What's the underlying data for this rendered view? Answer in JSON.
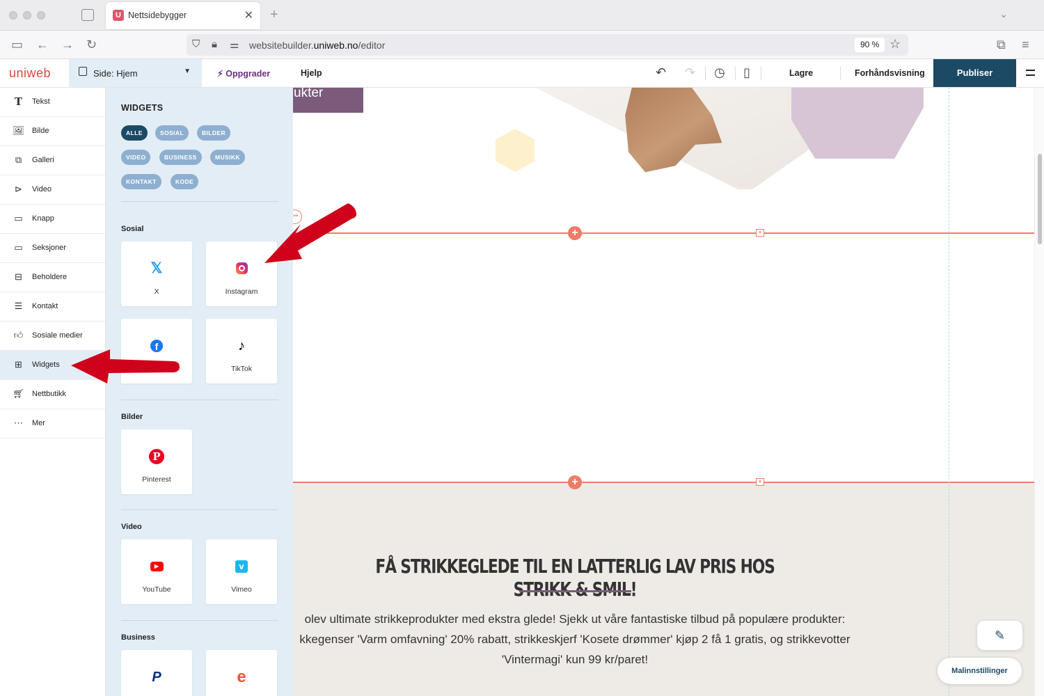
{
  "browser": {
    "tab_title": "Nettsidebygger",
    "tab_favicon": "U",
    "url_prefix": "websitebuilder.",
    "url_domain": "uniweb.no",
    "url_path": "/editor",
    "zoom": "90 %"
  },
  "toolbar": {
    "logo": "uniweb",
    "page_label": "Side: Hjem",
    "upgrade": "Oppgrader",
    "help": "Hjelp",
    "save": "Lagre",
    "preview": "Forhåndsvisning",
    "publish": "Publiser"
  },
  "sidebar": {
    "items": [
      {
        "label": "Tekst",
        "icon": "text-icon"
      },
      {
        "label": "Bilde",
        "icon": "image-icon"
      },
      {
        "label": "Galleri",
        "icon": "gallery-icon"
      },
      {
        "label": "Video",
        "icon": "video-icon"
      },
      {
        "label": "Knapp",
        "icon": "button-icon"
      },
      {
        "label": "Seksjoner",
        "icon": "sections-icon"
      },
      {
        "label": "Beholdere",
        "icon": "containers-icon"
      },
      {
        "label": "Kontakt",
        "icon": "contact-icon"
      },
      {
        "label": "Sosiale medier",
        "icon": "thumbs-up-icon"
      },
      {
        "label": "Widgets",
        "icon": "widgets-icon",
        "active": true
      },
      {
        "label": "Nettbutikk",
        "icon": "cart-icon"
      },
      {
        "label": "Mer",
        "icon": "more-icon"
      }
    ]
  },
  "widgets_panel": {
    "title": "WIDGETS",
    "filters": [
      "ALLE",
      "SOSIAL",
      "BILDER",
      "VIDEO",
      "BUSINESS",
      "MUSIKK",
      "KONTAKT",
      "KODE"
    ],
    "sections": {
      "sosial": {
        "title": "Sosial",
        "items": [
          "X",
          "Instagram",
          "",
          "TikTok"
        ]
      },
      "bilder": {
        "title": "Bilder",
        "items": [
          "Pinterest"
        ]
      },
      "video": {
        "title": "Video",
        "items": [
          "YouTube",
          "Vimeo"
        ]
      },
      "business": {
        "title": "Business",
        "items": [
          "",
          ""
        ]
      }
    },
    "colors": {
      "x": "#1d9bf0",
      "instagram": "#c13584",
      "facebook": "#1877f2",
      "tiktok": "#000000",
      "pinterest": "#e60023",
      "youtube": "#ff0000",
      "vimeo": "#1ab7ea",
      "paypal": "#003087",
      "eventbrite": "#f05537"
    }
  },
  "canvas": {
    "hero_button_text": "ukter",
    "headline": "FÅ STRIKKEGLEDE TIL EN LATTERLIG LAV PRIS HOS STRIKK & SMIL!",
    "body_lines": [
      "olev ultimate strikkeprodukter med ekstra glede! Sjekk ut våre fantastiske tilbud på populære produkter:",
      "kkegenser 'Varm omfavning' 20% rabatt, strikkeskjerf 'Kosete drømmer' kjøp 2 få 1 gratis, og strikkevotter",
      "'Vintermagi' kun 99 kr/paret!"
    ]
  },
  "floating": {
    "template_settings": "Malinnstillinger"
  }
}
